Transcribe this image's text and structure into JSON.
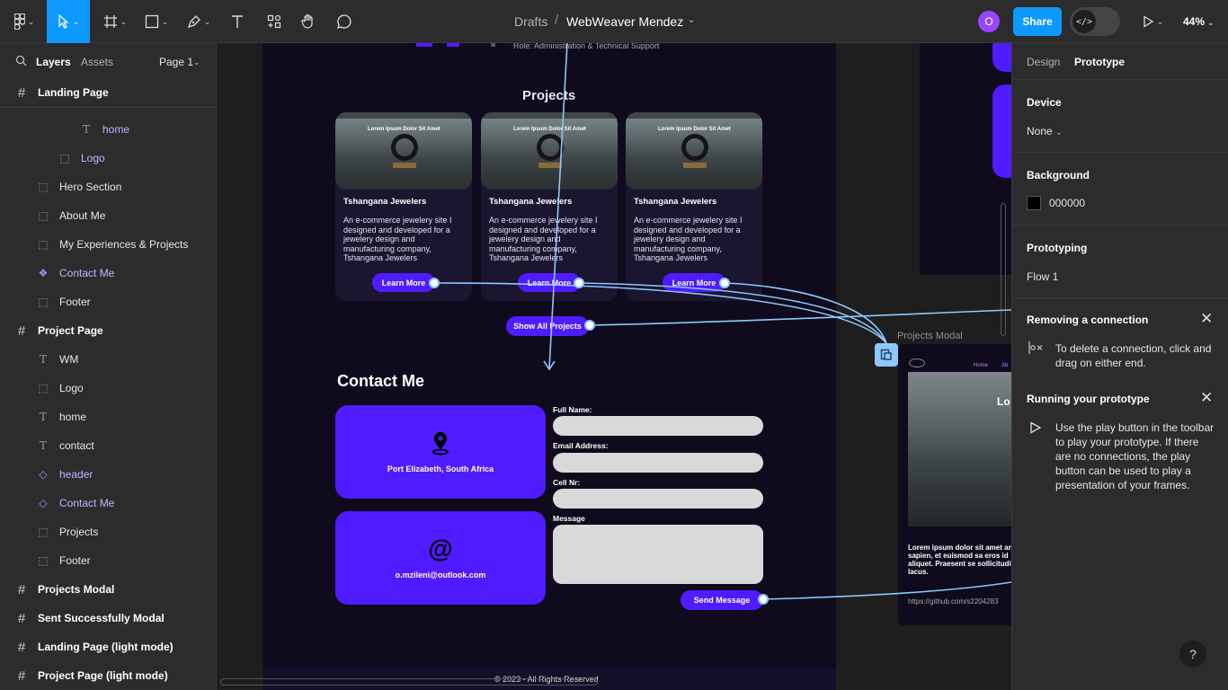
{
  "toolbar": {
    "breadcrumb_root": "Drafts",
    "breadcrumb_sep": "/",
    "file_name": "WebWeaver Mendez",
    "caret": "⌄",
    "avatar_initial": "O",
    "share_label": "Share",
    "devmode_glyph": "</>",
    "zoom": "44%",
    "accent": "#0d99ff"
  },
  "left_panel": {
    "tab_layers": "Layers",
    "tab_assets": "Assets",
    "page_selector": "Page 1",
    "layers": [
      {
        "label": "Landing Page",
        "icon": "frame-icon"
      },
      {
        "label": "home",
        "icon": "text-icon"
      },
      {
        "label": "Logo",
        "icon": "group-icon"
      },
      {
        "label": "Hero Section",
        "icon": "group-icon"
      },
      {
        "label": "About Me",
        "icon": "group-icon"
      },
      {
        "label": "My Experiences & Projects",
        "icon": "group-icon"
      },
      {
        "label": "Contact Me",
        "icon": "component-icon"
      },
      {
        "label": "Footer",
        "icon": "group-icon"
      },
      {
        "label": "Project Page",
        "icon": "frame-icon"
      },
      {
        "label": "WM",
        "icon": "text-icon"
      },
      {
        "label": "Logo",
        "icon": "group-icon"
      },
      {
        "label": "home",
        "icon": "text-icon"
      },
      {
        "label": "contact",
        "icon": "text-icon"
      },
      {
        "label": "header",
        "icon": "instance-icon"
      },
      {
        "label": "Contact Me",
        "icon": "instance-icon"
      },
      {
        "label": "Projects",
        "icon": "group-icon"
      },
      {
        "label": "Footer",
        "icon": "group-icon"
      },
      {
        "label": "Projects Modal",
        "icon": "frame-icon"
      },
      {
        "label": "Sent Successfully Modal",
        "icon": "frame-icon"
      },
      {
        "label": "Landing Page (light mode)",
        "icon": "frame-icon"
      },
      {
        "label": "Project Page (light mode)",
        "icon": "frame-icon"
      }
    ]
  },
  "canvas": {
    "top_fragment": "Role: Administration & Technical Support",
    "projects_title": "Projects",
    "cards": [
      {
        "hero_headline": "Lorem Ipsum Dolor Sit Amet",
        "name": "Tshangana Jewelers",
        "desc": "An e-commerce jewelery site I designed and developed for a jewelery design and manufacturing company, Tshangana Jewelers",
        "button": "Learn More"
      },
      {
        "hero_headline": "Lorem Ipsum Dolor Sit Amet",
        "name": "Tshangana Jewelers",
        "desc": "An e-commerce jewelery site I designed and developed for a jewelery design and manufacturing company, Tshangana Jewelers",
        "button": "Learn More"
      },
      {
        "hero_headline": "Lorem Ipsum Dolor Sit Amet",
        "name": "Tshangana Jewelers",
        "desc": "An e-commerce jewelery site I designed and developed for a jewelery design and manufacturing company, Tshangana Jewelers",
        "button": "Learn More"
      }
    ],
    "show_all": "Show All Projects",
    "contact_title": "Contact Me",
    "location": "Port Elizabeth, South Africa",
    "email_symbol": "@",
    "email": "o.mzileni@outlook.com",
    "form_labels": {
      "name": "Full Name:",
      "email": "Email Address:",
      "cell": "Cell Nr:",
      "message": "Message"
    },
    "send_button": "Send Message",
    "footer": "©  2023 - All Rights Reserved",
    "modal_label": "Projects Modal",
    "modal": {
      "nav_home": "Home",
      "nav_about": "Ab",
      "heading": "Lo",
      "paragraph": "Lorem ipsum dolor sit amet ante sapien, et euismod sa eros id aliquet. Praesent se sollicitudin lacus.",
      "link": "https://github.com/s2204283"
    },
    "brand_purple": "#4f1bff",
    "connection_color": "#8cc8ff"
  },
  "right_panel": {
    "tab_design": "Design",
    "tab_prototype": "Prototype",
    "device_header": "Device",
    "device_value": "None",
    "background_header": "Background",
    "background_value": "000000",
    "prototyping_header": "Prototyping",
    "flow_value": "Flow 1",
    "tip1_title": "Removing a connection",
    "tip1_body": "To delete a connection, click and drag on either end.",
    "tip2_title": "Running your prototype",
    "tip2_body": "Use the play button in the toolbar to play your prototype. If there are no connections, the play button can be used to play a presentation of your frames.",
    "help": "?"
  }
}
